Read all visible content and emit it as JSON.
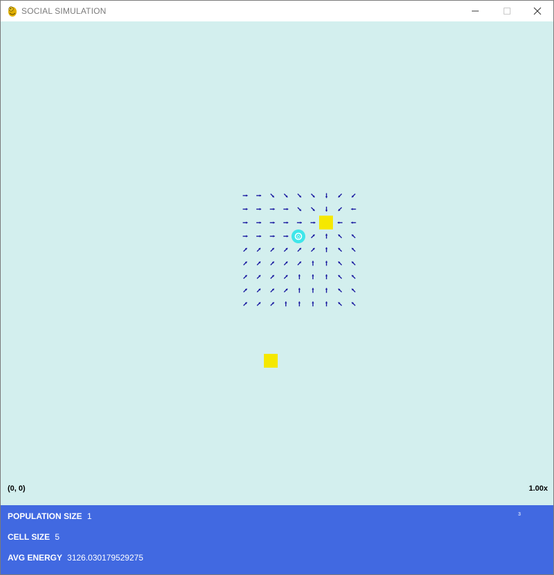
{
  "window": {
    "title": "SOCIAL SIMULATION",
    "controls": {
      "minimize_icon": "minimize-icon",
      "maximize_icon": "maximize-icon",
      "close_icon": "close-icon"
    }
  },
  "canvas": {
    "background": "#d3efee",
    "camera_coordinate": "(0, 0)",
    "zoom_level": "1.00x",
    "agent": {
      "label": "0",
      "color": "#3fe6ea"
    },
    "food_color": "#f5e800",
    "arrow_color": "#1a1aa0",
    "vector_field": {
      "rows": 9,
      "cols": 9,
      "arrows": [
        [
          "e",
          "e",
          "se",
          "se",
          "se",
          "se",
          "s",
          "sw",
          "sw"
        ],
        [
          "e",
          "e",
          "e",
          "e",
          "se",
          "se",
          "s",
          "sw",
          "w"
        ],
        [
          "e",
          "e",
          "e",
          "e",
          "e",
          "e",
          "w",
          "w",
          "w"
        ],
        [
          "e",
          "e",
          "e",
          "e",
          "",
          "ne",
          "n",
          "nw",
          "nw"
        ],
        [
          "ne",
          "ne",
          "ne",
          "ne",
          "ne",
          "ne",
          "n",
          "nw",
          "nw"
        ],
        [
          "ne",
          "ne",
          "ne",
          "ne",
          "ne",
          "n",
          "n",
          "nw",
          "nw"
        ],
        [
          "ne",
          "ne",
          "ne",
          "ne",
          "n",
          "n",
          "n",
          "nw",
          "nw"
        ],
        [
          "ne",
          "ne",
          "ne",
          "ne",
          "n",
          "n",
          "n",
          "nw",
          "nw"
        ],
        [
          "ne",
          "ne",
          "ne",
          "n",
          "n",
          "n",
          "n",
          "nw",
          "nw"
        ]
      ]
    }
  },
  "panel": {
    "background": "#4169e1",
    "population_label": "POPULATION SIZE",
    "population_value": "1",
    "cell_size_label": "CELL SIZE",
    "cell_size_value": "5",
    "avg_energy_label": "AVG ENERGY",
    "avg_energy_value": "3126.030179529275",
    "corner_number": "3"
  }
}
